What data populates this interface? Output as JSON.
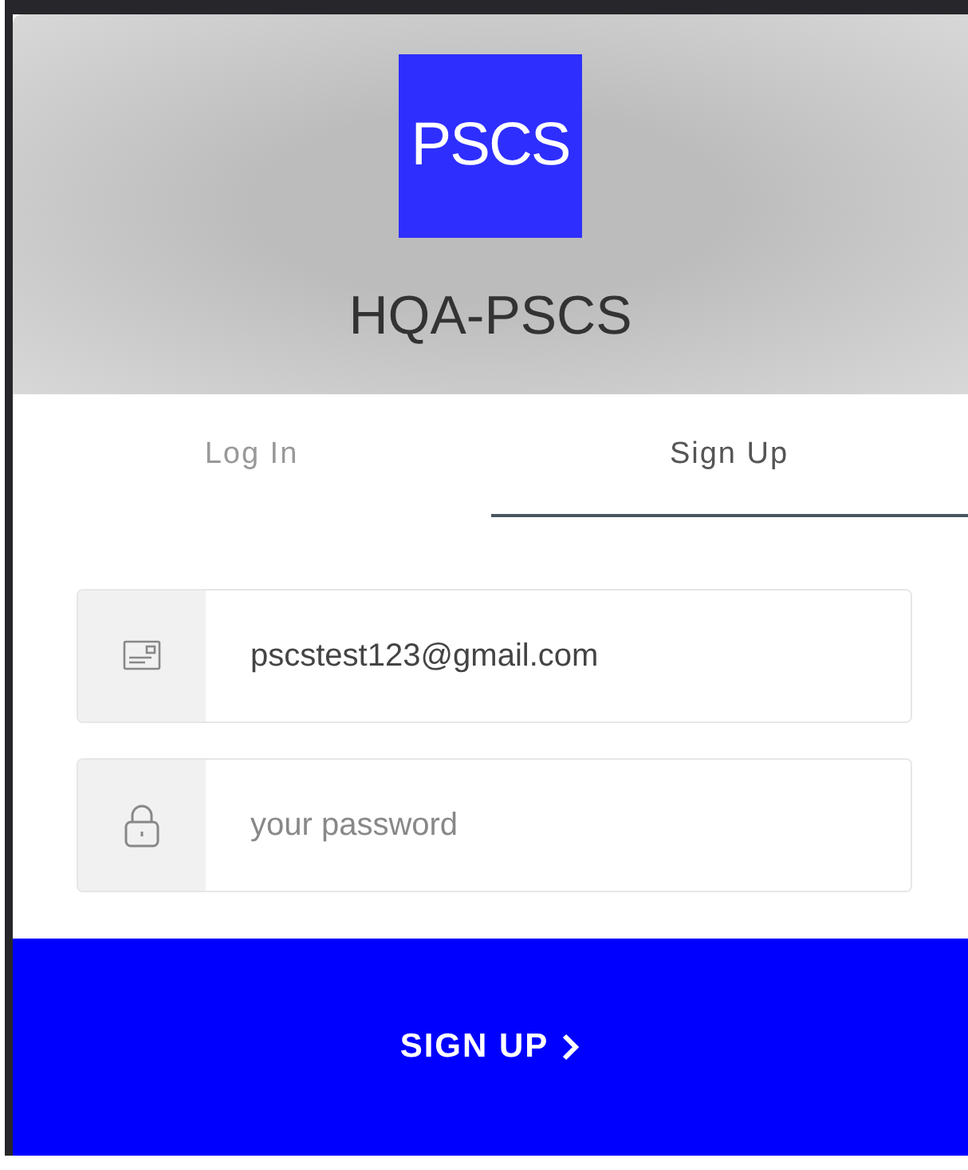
{
  "header": {
    "logo": "PSCS",
    "title": "HQA-PSCS"
  },
  "tabs": [
    {
      "label": "Log In",
      "selected": false
    },
    {
      "label": "Sign Up",
      "selected": true
    }
  ],
  "fields": [
    {
      "kind": "email",
      "value": "pscstest123@gmail.com"
    },
    {
      "kind": "password",
      "placeholder": "your password"
    }
  ],
  "submit": {
    "label": "SIGN UP"
  }
}
